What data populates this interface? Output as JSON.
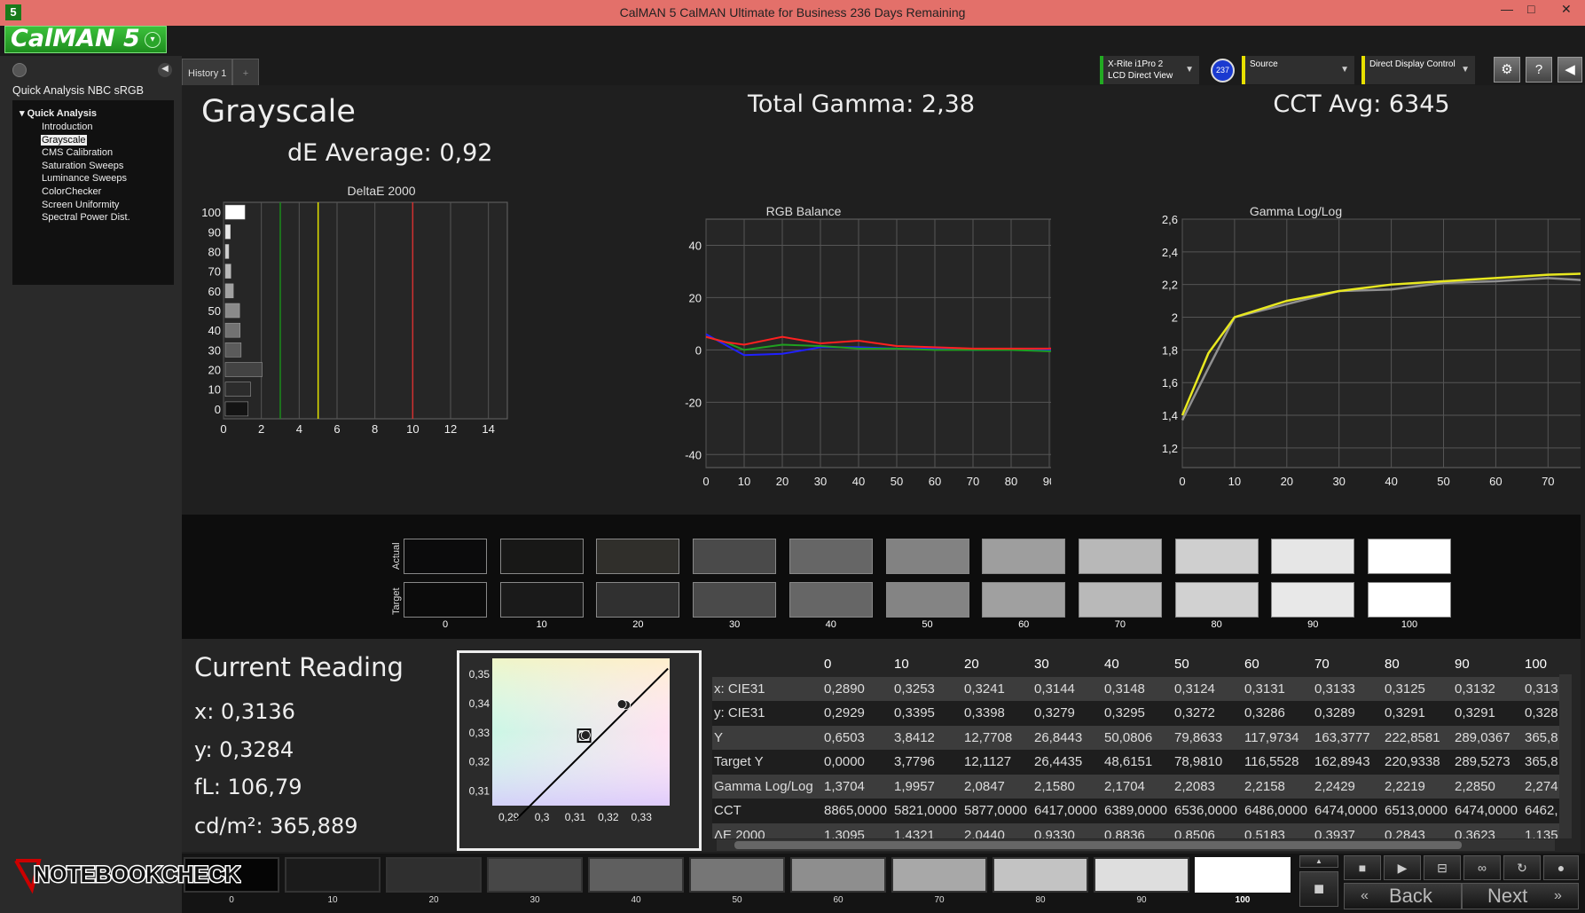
{
  "window": {
    "title": "CalMAN 5 CalMAN Ultimate for Business 236 Days Remaining",
    "app_icon": "5",
    "minimize": "—",
    "maximize": "□",
    "close": "✕"
  },
  "logo": {
    "text": "CalMAN 5",
    "dropdown": "▾"
  },
  "sidebar": {
    "workflow_title": "Quick Analysis NBC sRGB",
    "root": "Quick Analysis",
    "items": [
      {
        "label": "Introduction"
      },
      {
        "label": "Grayscale",
        "selected": true
      },
      {
        "label": "CMS Calibration"
      },
      {
        "label": "Saturation Sweeps"
      },
      {
        "label": "Luminance Sweeps"
      },
      {
        "label": "ColorChecker"
      },
      {
        "label": "Screen Uniformity"
      },
      {
        "label": "Spectral Power Dist."
      }
    ],
    "collapse": "◀"
  },
  "tabs": [
    {
      "label": "History 1"
    },
    {
      "label": "+"
    }
  ],
  "devices": {
    "meter": {
      "line1": "X-Rite i1Pro 2",
      "line2": "LCD Direct View",
      "accent": "#22aa22"
    },
    "meter_badge": "237",
    "source": {
      "line1": "Source",
      "accent": "#e8e000"
    },
    "display": {
      "line1": "Direct Display Control",
      "accent": "#e8e000"
    },
    "buttons": [
      "⚙",
      "?",
      "◀"
    ]
  },
  "grayscale": {
    "title": "Grayscale",
    "de_average": "dE Average: 0,92",
    "total_gamma": "Total Gamma: 2,38",
    "cct_avg": "CCT Avg: 6345"
  },
  "chart_data": [
    {
      "type": "bar",
      "title": "DeltaE 2000",
      "orientation": "horizontal",
      "categories": [
        "0",
        "10",
        "20",
        "30",
        "40",
        "50",
        "60",
        "70",
        "80",
        "90",
        "100"
      ],
      "values": [
        1.3,
        1.43,
        2.04,
        0.93,
        0.88,
        0.85,
        0.52,
        0.39,
        0.28,
        0.36,
        1.13
      ],
      "xlim": [
        0,
        15
      ],
      "xticks": [
        "0",
        "2",
        "4",
        "6",
        "8",
        "10",
        "12",
        "14"
      ],
      "thresholds": [
        {
          "value": 3,
          "color": "#1a8a1a"
        },
        {
          "value": 5,
          "color": "#e0e000"
        },
        {
          "value": 10,
          "color": "#d03030"
        }
      ],
      "grid": true
    },
    {
      "type": "line",
      "title": "RGB Balance",
      "x": [
        0,
        5,
        10,
        20,
        30,
        40,
        50,
        60,
        70,
        80,
        90,
        100
      ],
      "series": [
        {
          "color": "#ff2020",
          "values": [
            5,
            3,
            2,
            5,
            2.5,
            3.5,
            1.5,
            1,
            0.5,
            0.5,
            0.5,
            2
          ]
        },
        {
          "color": "#20a020",
          "values": [
            5,
            3,
            0,
            2,
            1.5,
            0.5,
            0.5,
            0,
            0,
            0,
            -0.5,
            0
          ]
        },
        {
          "color": "#2020ff",
          "values": [
            6,
            2,
            -2,
            -1.5,
            1,
            1,
            0.5,
            0.5,
            0,
            0.5,
            0,
            0.5
          ]
        }
      ],
      "xticks": [
        "0",
        "10",
        "20",
        "30",
        "40",
        "50",
        "60",
        "70",
        "80",
        "90",
        "100"
      ],
      "yticks": [
        "40",
        "20",
        "0",
        "-20",
        "-40"
      ],
      "ylim": [
        -45,
        50
      ],
      "grid": true
    },
    {
      "type": "line",
      "title": "Gamma Log/Log",
      "x": [
        0,
        5,
        10,
        20,
        30,
        40,
        50,
        60,
        70,
        80,
        90,
        100
      ],
      "series": [
        {
          "color": "#e8e820",
          "values": [
            1.4,
            1.78,
            2.0,
            2.1,
            2.16,
            2.2,
            2.22,
            2.24,
            2.26,
            2.27,
            2.28,
            2.28
          ]
        },
        {
          "color": "#909090",
          "values": [
            1.37,
            1.69,
            2.0,
            2.08,
            2.16,
            2.17,
            2.21,
            2.22,
            2.24,
            2.22,
            2.29,
            2.28
          ]
        }
      ],
      "xticks": [
        "0",
        "10",
        "20",
        "30",
        "40",
        "50",
        "60",
        "70",
        "80",
        "90",
        "100"
      ],
      "yticks": [
        "2,6",
        "2,4",
        "2,2",
        "2",
        "1,8",
        "1,6",
        "1,4",
        "1,2"
      ],
      "ylim": [
        1.08,
        2.6
      ],
      "grid": true
    },
    {
      "type": "scatter",
      "xlim": [
        0.285,
        0.3385
      ],
      "ylim": [
        0.305,
        0.3555
      ],
      "xticks": [
        "0,29",
        "0,3",
        "0,31",
        "0,32",
        "0,33"
      ],
      "yticks": [
        "0,35",
        "0,34",
        "0,33",
        "0,32",
        "0,31"
      ],
      "points": [
        {
          "x": 0.3124,
          "y": 0.3289
        },
        {
          "x": 0.3132,
          "y": 0.3292
        },
        {
          "x": 0.3253,
          "y": 0.3395
        },
        {
          "x": 0.3241,
          "y": 0.3398
        }
      ],
      "target": {
        "x": 0.3127,
        "y": 0.329
      },
      "locus": [
        [
          0.292,
          0.3
        ],
        [
          0.338,
          0.352
        ]
      ]
    }
  ],
  "swatches": {
    "actual_label": "Actual",
    "target_label": "Target",
    "labels": [
      "0",
      "10",
      "20",
      "30",
      "40",
      "50",
      "60",
      "70",
      "80",
      "90",
      "100"
    ],
    "actual": [
      "#0b0b0c",
      "#181817",
      "#302f2b",
      "#4a4a4a",
      "#666666",
      "#828282",
      "#9e9e9e",
      "#b8b8b8",
      "#cfcfcf",
      "#e6e6e6",
      "#ffffff"
    ],
    "target": [
      "#0b0b0b",
      "#1a1a1a",
      "#303030",
      "#4a4a4a",
      "#666666",
      "#848484",
      "#a0a0a0",
      "#b9b9b9",
      "#d1d1d1",
      "#e8e8e8",
      "#ffffff"
    ]
  },
  "reading": {
    "title": "Current Reading",
    "x": "x: 0,3136",
    "y": "y: 0,3284",
    "fl": "fL: 106,79",
    "cdm": "cd/m²: 365,889"
  },
  "table": {
    "headers": [
      "",
      "0",
      "10",
      "20",
      "30",
      "40",
      "50",
      "60",
      "70",
      "80",
      "90",
      "100"
    ],
    "rows": [
      [
        "x: CIE31",
        "0,2890",
        "0,3253",
        "0,3241",
        "0,3144",
        "0,3148",
        "0,3124",
        "0,3131",
        "0,3133",
        "0,3125",
        "0,3132",
        "0,313"
      ],
      [
        "y: CIE31",
        "0,2929",
        "0,3395",
        "0,3398",
        "0,3279",
        "0,3295",
        "0,3272",
        "0,3286",
        "0,3289",
        "0,3291",
        "0,3291",
        "0,328"
      ],
      [
        "Y",
        "0,6503",
        "3,8412",
        "12,7708",
        "26,8443",
        "50,0806",
        "79,8633",
        "117,9734",
        "163,3777",
        "222,8581",
        "289,0367",
        "365,8"
      ],
      [
        "Target Y",
        "0,0000",
        "3,7796",
        "12,1127",
        "26,4435",
        "48,6151",
        "78,9810",
        "116,5528",
        "162,8943",
        "220,9338",
        "289,5273",
        "365,8"
      ],
      [
        "Gamma Log/Log",
        "1,3704",
        "1,9957",
        "2,0847",
        "2,1580",
        "2,1704",
        "2,2083",
        "2,2158",
        "2,2429",
        "2,2219",
        "2,2850",
        "2,274"
      ],
      [
        "CCT",
        "8865,0000",
        "5821,0000",
        "5877,0000",
        "6417,0000",
        "6389,0000",
        "6536,0000",
        "6486,0000",
        "6474,0000",
        "6513,0000",
        "6474,0000",
        "6462,"
      ],
      [
        "ΔE 2000",
        "1,3095",
        "1,4321",
        "2,0440",
        "0,9330",
        "0,8836",
        "0,8506",
        "0,5183",
        "0,3937",
        "0,2843",
        "0,3623",
        "1,135"
      ]
    ]
  },
  "bottom": {
    "swatch_labels": [
      "0",
      "10",
      "20",
      "30",
      "40",
      "50",
      "60",
      "70",
      "80",
      "90",
      "100"
    ],
    "swatch_colors": [
      "#050505",
      "#1b1b1b",
      "#2f2f2f",
      "#474747",
      "#5f5f5f",
      "#767676",
      "#8e8e8e",
      "#a8a8a8",
      "#c3c3c3",
      "#dedede",
      "#ffffff"
    ],
    "selected": "100",
    "back": "Back",
    "next": "Next"
  },
  "watermark": {
    "text": "NOTEBOOKCHECK"
  }
}
